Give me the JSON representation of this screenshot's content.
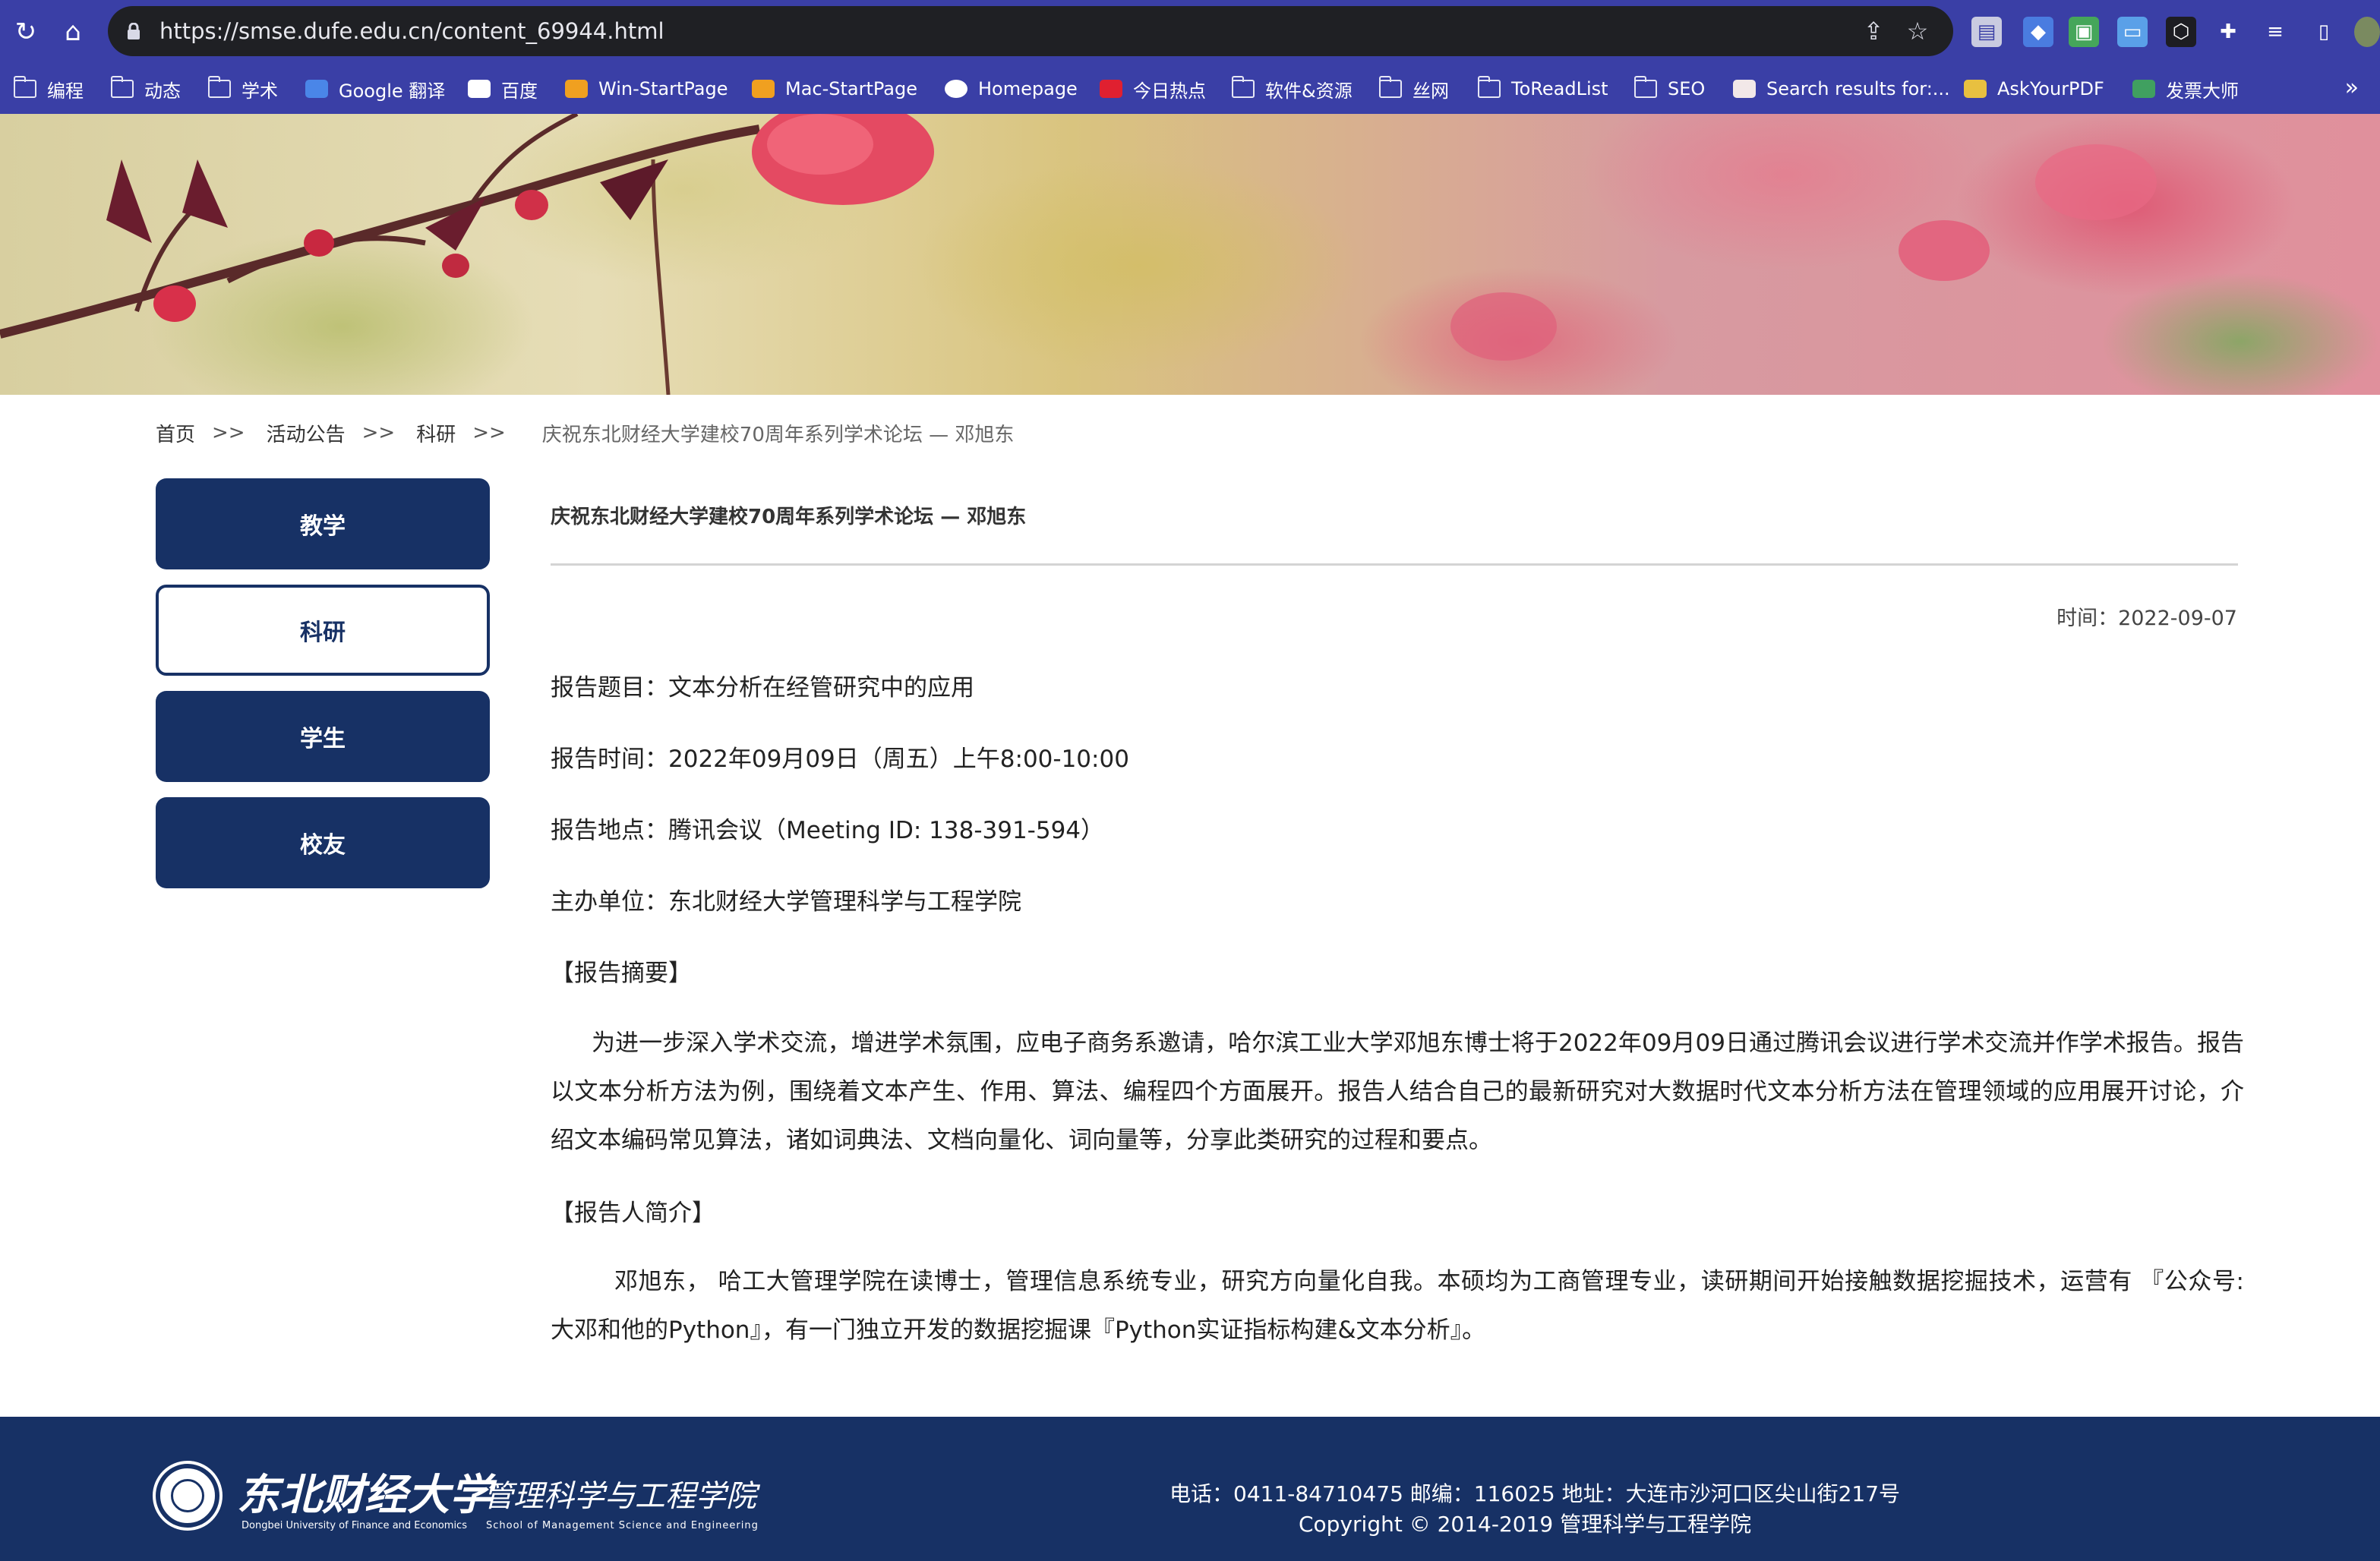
{
  "browser": {
    "url": "https://smse.dufe.edu.cn/content_69944.html",
    "bookmarks": [
      {
        "label": "编程",
        "icon": "folder-icon"
      },
      {
        "label": "动态",
        "icon": "folder-icon"
      },
      {
        "label": "学术",
        "icon": "folder-icon"
      },
      {
        "label": "Google 翻译",
        "icon": "google-translate-icon"
      },
      {
        "label": "百度",
        "icon": "baidu-icon"
      },
      {
        "label": "Win-StartPage",
        "icon": "home-icon"
      },
      {
        "label": "Mac-StartPage",
        "icon": "home-icon"
      },
      {
        "label": "Homepage",
        "icon": "globe-icon"
      },
      {
        "label": "今日热点",
        "icon": "r-logo-icon"
      },
      {
        "label": "软件&资源",
        "icon": "folder-icon"
      },
      {
        "label": "丝网",
        "icon": "folder-icon"
      },
      {
        "label": "ToReadList",
        "icon": "folder-icon"
      },
      {
        "label": "SEO",
        "icon": "folder-icon"
      },
      {
        "label": "Search results for:...",
        "icon": "site-icon"
      },
      {
        "label": "AskYourPDF",
        "icon": "pdf-icon"
      },
      {
        "label": "发票大师",
        "icon": "invoice-icon"
      }
    ],
    "more_glyph": "»"
  },
  "breadcrumb": {
    "items": [
      "首页",
      "活动公告",
      "科研"
    ],
    "separator": ">>",
    "current": "庆祝东北财经大学建校70周年系列学术论坛 — 邓旭东"
  },
  "sidebar": {
    "items": [
      {
        "label": "教学",
        "active": false
      },
      {
        "label": "科研",
        "active": true
      },
      {
        "label": "学生",
        "active": false
      },
      {
        "label": "校友",
        "active": false
      }
    ]
  },
  "article": {
    "title": "庆祝东北财经大学建校70周年系列学术论坛 — 邓旭东",
    "time": "时间：2022-09-07",
    "fields": [
      "报告题目：文本分析在经管研究中的应用",
      "报告时间：2022年09月09日（周五）上午8:00-10:00",
      "报告地点：腾讯会议（Meeting ID: 138-391-594）",
      "主办单位：东北财经大学管理科学与工程学院"
    ],
    "abstract_heading": "【报告摘要】",
    "abstract": "为进一步深入学术交流，增进学术氛围，应电子商务系邀请，哈尔滨工业大学邓旭东博士将于2022年09月09日通过腾讯会议进行学术交流并作学术报告。报告以文本分析方法为例，围绕着文本产生、作用、算法、编程四个方面展开。报告人结合自己的最新研究对大数据时代文本分析方法在管理领域的应用展开讨论，介绍文本编码常见算法，诸如词典法、文档向量化、词向量等，分享此类研究的过程和要点。",
    "bio_heading": "【报告人简介】",
    "bio": "邓旭东， 哈工大管理学院在读博士，管理信息系统专业，研究方向量化自我。本硕均为工商管理专业，读研期间开始接触数据挖掘技术，运营有 『公众号: 大邓和他的Python』，有一门独立开发的数据挖掘课『Python实证指标构建&文本分析』。"
  },
  "footer": {
    "logo_cn": "东北财经大学",
    "logo_en": "Dongbei University of Finance and Economics",
    "school_cn": "管理科学与工程学院",
    "school_en": "School of Management Science and Engineering",
    "contact": "电话：0411-84710475 邮编：116025 地址：大连市沙河口区尖山街217号",
    "copyright": "Copyright © 2014-2019 管理科学与工程学院"
  },
  "colors": {
    "chrome": "#3a3fa6",
    "navy": "#173165"
  }
}
